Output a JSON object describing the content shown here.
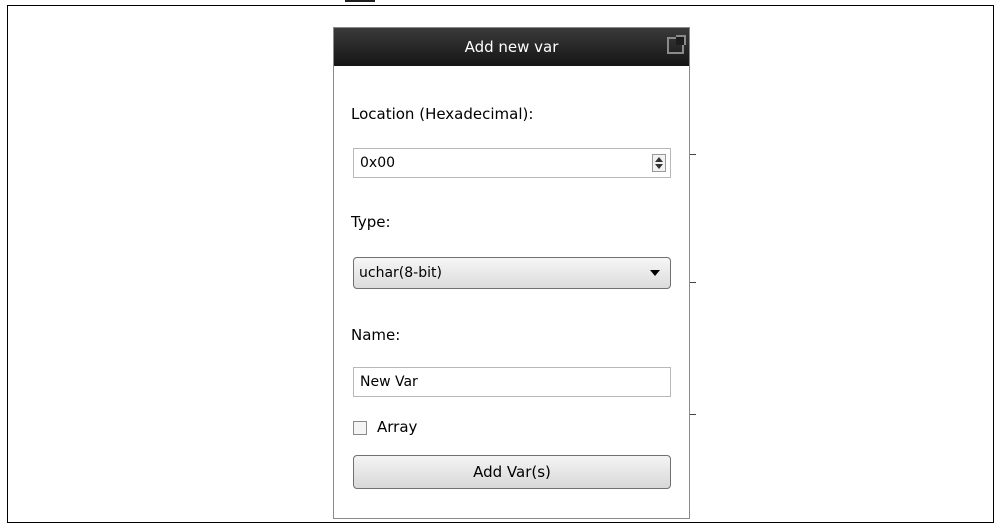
{
  "dialog": {
    "title": "Add new var"
  },
  "location": {
    "label": "Location (Hexadecimal):",
    "value": "0x00"
  },
  "type": {
    "label": "Type:",
    "selected": "uchar(8-bit)"
  },
  "name": {
    "label": "Name:",
    "value": "New Var"
  },
  "array": {
    "label": "Array",
    "checked": false
  },
  "add_button": {
    "label": "Add Var(s)"
  },
  "icons": {
    "popout": "popout-icon",
    "spinner": "spinner-icon",
    "dropdown": "chevron-down-icon"
  }
}
